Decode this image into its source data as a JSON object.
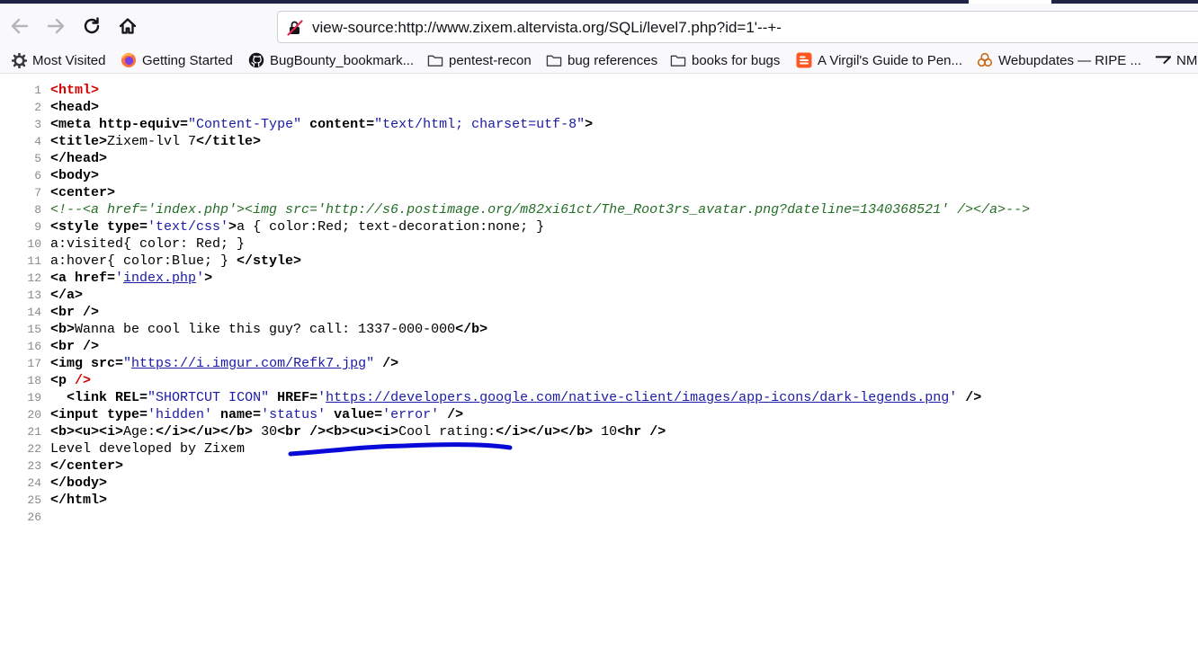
{
  "browser": {
    "url": "view-source:http://www.zixem.altervista.org/SQLi/level7.php?id=1'--+-",
    "bookmarks": [
      {
        "label": "Most Visited",
        "icon": "gear-icon"
      },
      {
        "label": "Getting Started",
        "icon": "firefox-icon"
      },
      {
        "label": "BugBounty_bookmark...",
        "icon": "github-icon"
      },
      {
        "label": "pentest-recon",
        "icon": "folder-icon"
      },
      {
        "label": "bug references",
        "icon": "folder-icon"
      },
      {
        "label": "books for bugs",
        "icon": "folder-icon"
      },
      {
        "label": "A Virgil's Guide to Pen...",
        "icon": "blogger-icon"
      },
      {
        "label": "Webupdates — RIPE ...",
        "icon": "ripe-icon"
      },
      {
        "label": "NM",
        "icon": "nmap-icon"
      }
    ]
  },
  "source": {
    "line_numbers": [
      "1",
      "2",
      "3",
      "4",
      "5",
      "6",
      "7",
      "8",
      "9",
      "10",
      "11",
      "12",
      "13",
      "14",
      "15",
      "16",
      "17",
      "18",
      "19",
      "20",
      "21",
      "22",
      "23",
      "24",
      "25",
      "26"
    ],
    "l1": {
      "tag": "<html>"
    },
    "l2": {
      "tag": "<head>"
    },
    "l3": {
      "open": "<meta",
      "a1": " http-equiv=",
      "v1": "\"Content-Type\"",
      "a2": " content=",
      "v2": "\"text/html; charset=utf-8\"",
      "close": ">"
    },
    "l4": {
      "open": "<title>",
      "text": "Zixem-lvl 7",
      "close": "</title>"
    },
    "l5": {
      "tag": "</head>"
    },
    "l6": {
      "tag": "<body>"
    },
    "l7": {
      "tag": "<center>"
    },
    "l8": {
      "comment": "<!--<a href='index.php'><img src='http://s6.postimage.org/m82xi61ct/The_Root3rs_avatar.png?dateline=1340368521' /></a>-->"
    },
    "l9": {
      "open": "<style",
      "a1": " type=",
      "v1": "'text/css'",
      "close": ">",
      "text": "a { color:Red; text-decoration:none; }"
    },
    "l10": {
      "text": "a:visited{ color: Red; }"
    },
    "l11": {
      "text": "a:hover{ color:Blue; } ",
      "close": "</style>"
    },
    "l12": {
      "open": "<a",
      "a1": " href=",
      "q1": "'",
      "link": "index.php",
      "q2": "'",
      "close": ">"
    },
    "l13": {
      "tag": "</a>"
    },
    "l14": {
      "tag": "<br />"
    },
    "l15": {
      "open": "<b>",
      "text": "Wanna be cool like this guy? call: 1337-000-000",
      "close": "</b>"
    },
    "l16": {
      "tag": "<br />"
    },
    "l17": {
      "open": "<img",
      "a1": " src=",
      "q1": "\"",
      "link": "https://i.imgur.com/Refk7.jpg",
      "q2": "\"",
      "close": " />"
    },
    "l18": {
      "open": "<p",
      "close": " />"
    },
    "l19": {
      "indent": "  ",
      "open": "<link",
      "a1": " REL=",
      "v1": "\"SHORTCUT ICON\"",
      "a2": " HREF=",
      "q1": "'",
      "link": "https://developers.google.com/native-client/images/app-icons/dark-legends.png",
      "q2": "'",
      "close": " />"
    },
    "l20": {
      "open": "<input",
      "a1": " type=",
      "v1": "'hidden'",
      "a2": " name=",
      "v2": "'status'",
      "a3": " value=",
      "v3": "'error'",
      "close": " />"
    },
    "l21": {
      "t1": "<b><u><i>",
      "text1": "Age:",
      "t2": "</i></u></b>",
      "text2": " 30",
      "t3": "<br />",
      "t4": "<b><u><i>",
      "text3": "Cool rating:",
      "t5": "</i></u></b>",
      "text4": " 10",
      "t6": "<hr />"
    },
    "l22": {
      "text": "Level developed by Zixem"
    },
    "l23": {
      "tag": "</center>"
    },
    "l24": {
      "tag": "</body>"
    },
    "l25": {
      "tag": "</html>"
    }
  },
  "colors": {
    "tag_red": "#d20000",
    "attr_value": "#1a1aa6",
    "comment": "#236e25",
    "pen_annotation": "#0a0ad8"
  }
}
